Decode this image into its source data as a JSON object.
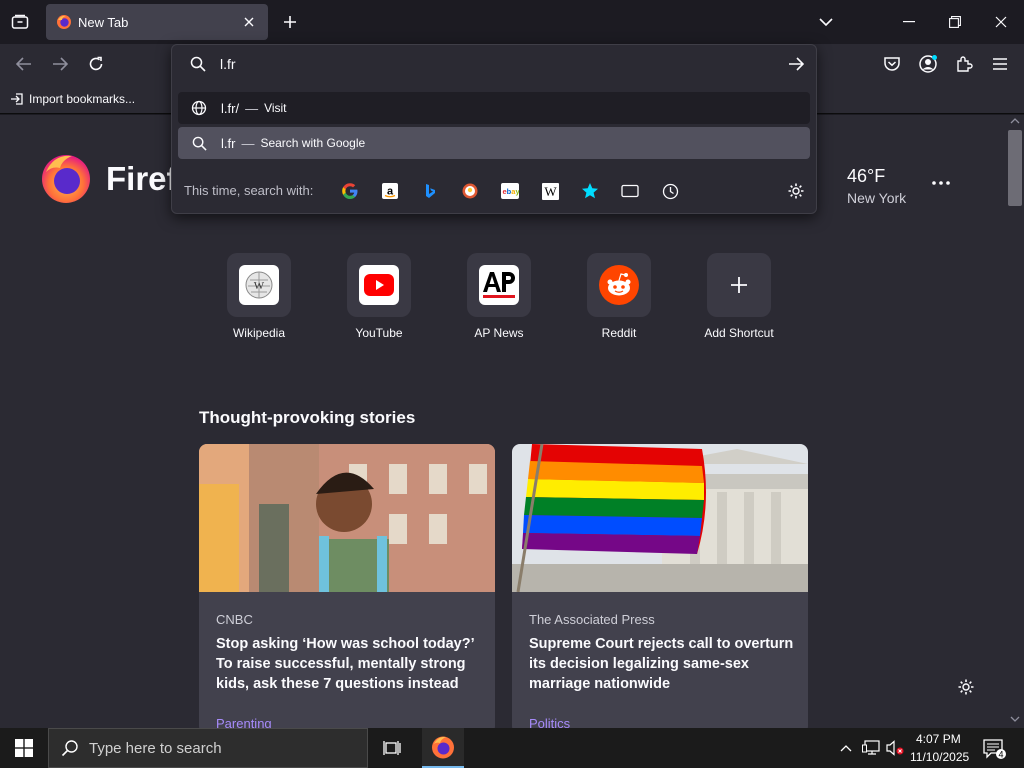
{
  "browser": {
    "active_tab": {
      "title": "New Tab"
    },
    "bookmarks_bar": {
      "import_label": "Import bookmarks..."
    }
  },
  "urlbar": {
    "value": "l.fr",
    "results": [
      {
        "text": "l.fr/",
        "separator": "—",
        "action": "Visit",
        "icon": "globe-icon"
      },
      {
        "text": "l.fr",
        "separator": "—",
        "action": "Search with Google",
        "icon": "search-icon"
      }
    ],
    "search_with_label": "This time, search with:",
    "engines": [
      "Google",
      "Amazon",
      "Bing",
      "DuckDuckGo",
      "eBay",
      "Wikipedia",
      "Bookmarks",
      "Tabs",
      "History"
    ]
  },
  "newtab": {
    "brand": "Firef",
    "weather": {
      "temp": "46°F",
      "city": "New York"
    },
    "shortcuts": [
      {
        "label": "Wikipedia"
      },
      {
        "label": "YouTube"
      },
      {
        "label": "AP News"
      },
      {
        "label": "Reddit"
      },
      {
        "label": "Add Shortcut"
      }
    ],
    "stories_heading": "Thought-provoking stories",
    "stories": [
      {
        "source": "CNBC",
        "title": "Stop asking ‘How was school today?’ To raise successful, mentally strong kids, ask these 7 questions instead",
        "category": "Parenting"
      },
      {
        "source": "The Associated Press",
        "title": "Supreme Court rejects call to overturn its decision legalizing same-sex marriage nationwide",
        "category": "Politics"
      }
    ]
  },
  "taskbar": {
    "search_placeholder": "Type here to search",
    "time": "4:07 PM",
    "date": "11/10/2025",
    "notification_count": "4"
  },
  "colors": {
    "accent": "#a78bfa",
    "chrome_bg": "#1c1b22",
    "toolbar_bg": "#2b2a33"
  }
}
